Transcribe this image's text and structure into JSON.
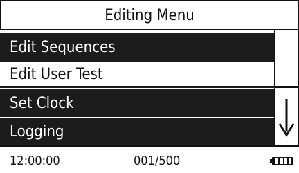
{
  "header": {
    "title": "Editing Menu"
  },
  "menu": {
    "items": [
      {
        "label": "Edit Sequences",
        "selected": false
      },
      {
        "label": "Edit User Test",
        "selected": true
      },
      {
        "label": "Set Clock",
        "selected": false
      },
      {
        "label": "Logging",
        "selected": false
      }
    ]
  },
  "scroll": {
    "down_icon": "arrow-down-icon"
  },
  "status": {
    "time": "12:00:00",
    "count": "001/500",
    "battery_icon": "battery-icon",
    "battery_level": 1.0
  }
}
